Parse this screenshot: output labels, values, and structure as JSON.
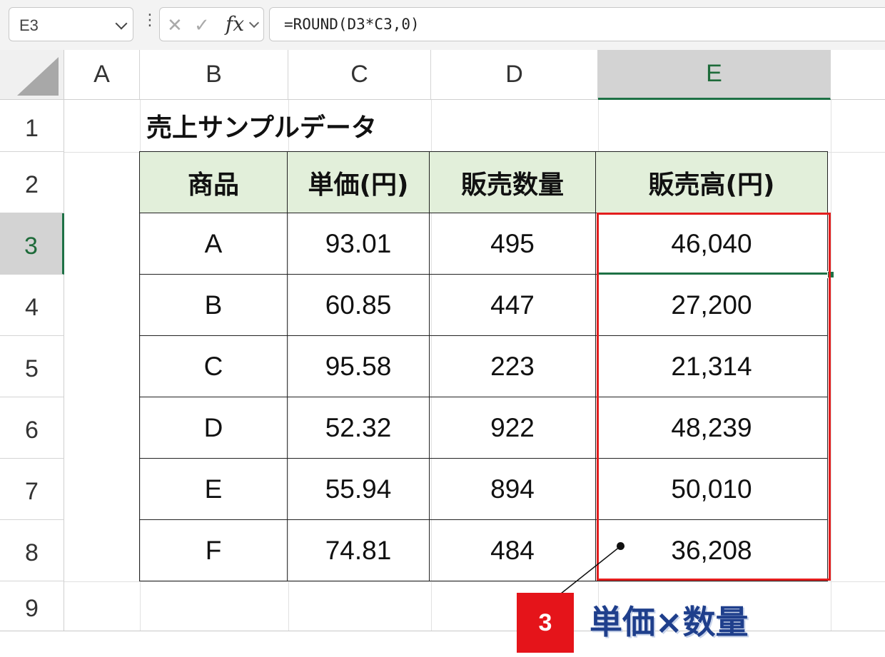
{
  "formula_bar": {
    "name_box": "E3",
    "formula": "=ROUND(D3*C3,0)",
    "fx_label": "fx"
  },
  "columns": [
    "A",
    "B",
    "C",
    "D",
    "E"
  ],
  "selected_column": "E",
  "rows": [
    "1",
    "2",
    "3",
    "4",
    "5",
    "6",
    "7",
    "8",
    "9"
  ],
  "selected_row": "3",
  "sheet": {
    "title": "売上サンプルデータ",
    "headers": [
      "商品",
      "単価(円)",
      "販売数量",
      "販売高(円)"
    ],
    "data_rows": [
      [
        "A",
        "93.01",
        "495",
        "46,040"
      ],
      [
        "B",
        "60.85",
        "447",
        "27,200"
      ],
      [
        "C",
        "95.58",
        "223",
        "21,314"
      ],
      [
        "D",
        "52.32",
        "922",
        "48,239"
      ],
      [
        "E",
        "55.94",
        "894",
        "50,010"
      ],
      [
        "F",
        "74.81",
        "484",
        "36,208"
      ]
    ]
  },
  "annotation": {
    "step": "3",
    "label": "単価×数量",
    "accent_color": "#e31d1d",
    "label_color": "#1f3f8c"
  }
}
